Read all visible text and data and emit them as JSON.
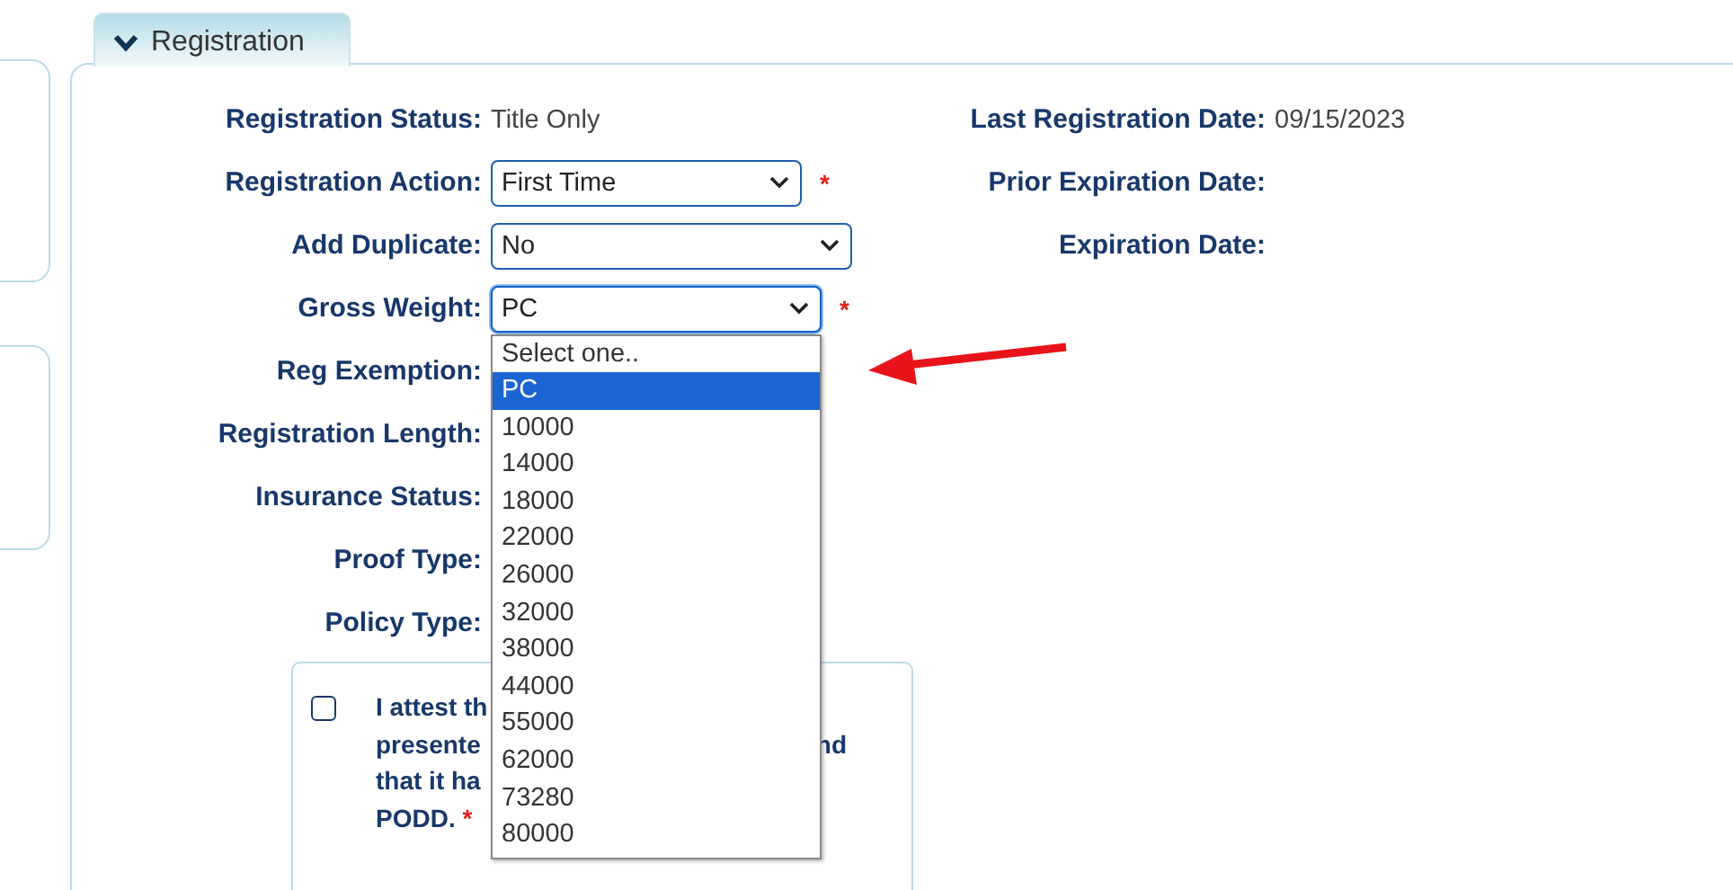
{
  "tab": {
    "label": "Registration",
    "expanded": true
  },
  "fields_left": [
    {
      "label": "Registration Status:",
      "kind": "text",
      "value": "Title Only"
    },
    {
      "label": "Registration Action:",
      "kind": "select",
      "value": "First Time",
      "required_mark": "*",
      "open": false
    },
    {
      "label": "Add Duplicate:",
      "kind": "select",
      "value": "No",
      "open": false
    },
    {
      "label": "Gross Weight:",
      "kind": "select",
      "value": "PC",
      "required_mark": "*",
      "open": true,
      "options": [
        {
          "label": "Select one..",
          "selected": false
        },
        {
          "label": "PC",
          "selected": true
        },
        {
          "label": "10000",
          "selected": false
        },
        {
          "label": "14000",
          "selected": false
        },
        {
          "label": "18000",
          "selected": false
        },
        {
          "label": "22000",
          "selected": false
        },
        {
          "label": "26000",
          "selected": false
        },
        {
          "label": "32000",
          "selected": false
        },
        {
          "label": "38000",
          "selected": false
        },
        {
          "label": "44000",
          "selected": false
        },
        {
          "label": "55000",
          "selected": false
        },
        {
          "label": "62000",
          "selected": false
        },
        {
          "label": "73280",
          "selected": false
        },
        {
          "label": "80000",
          "selected": false
        }
      ]
    },
    {
      "label": "Reg Exemption:",
      "kind": "empty"
    },
    {
      "label": "Registration Length:",
      "kind": "empty"
    },
    {
      "label": "Insurance Status:",
      "kind": "empty"
    },
    {
      "label": "Proof Type:",
      "kind": "empty"
    },
    {
      "label": "Policy Type:",
      "kind": "empty"
    }
  ],
  "fields_right": [
    {
      "label": "Last Registration Date:",
      "value": "09/15/2023"
    },
    {
      "label": "Prior Expiration Date:"
    },
    {
      "label": "Expiration Date:"
    }
  ],
  "attestation": {
    "checked": false,
    "lines": [
      {
        "left": "I attest th"
      },
      {
        "left": "presente",
        "right": "nd"
      },
      {
        "left": "that it ha"
      },
      {
        "left": "PODD.",
        "required_mark": "*"
      }
    ]
  }
}
